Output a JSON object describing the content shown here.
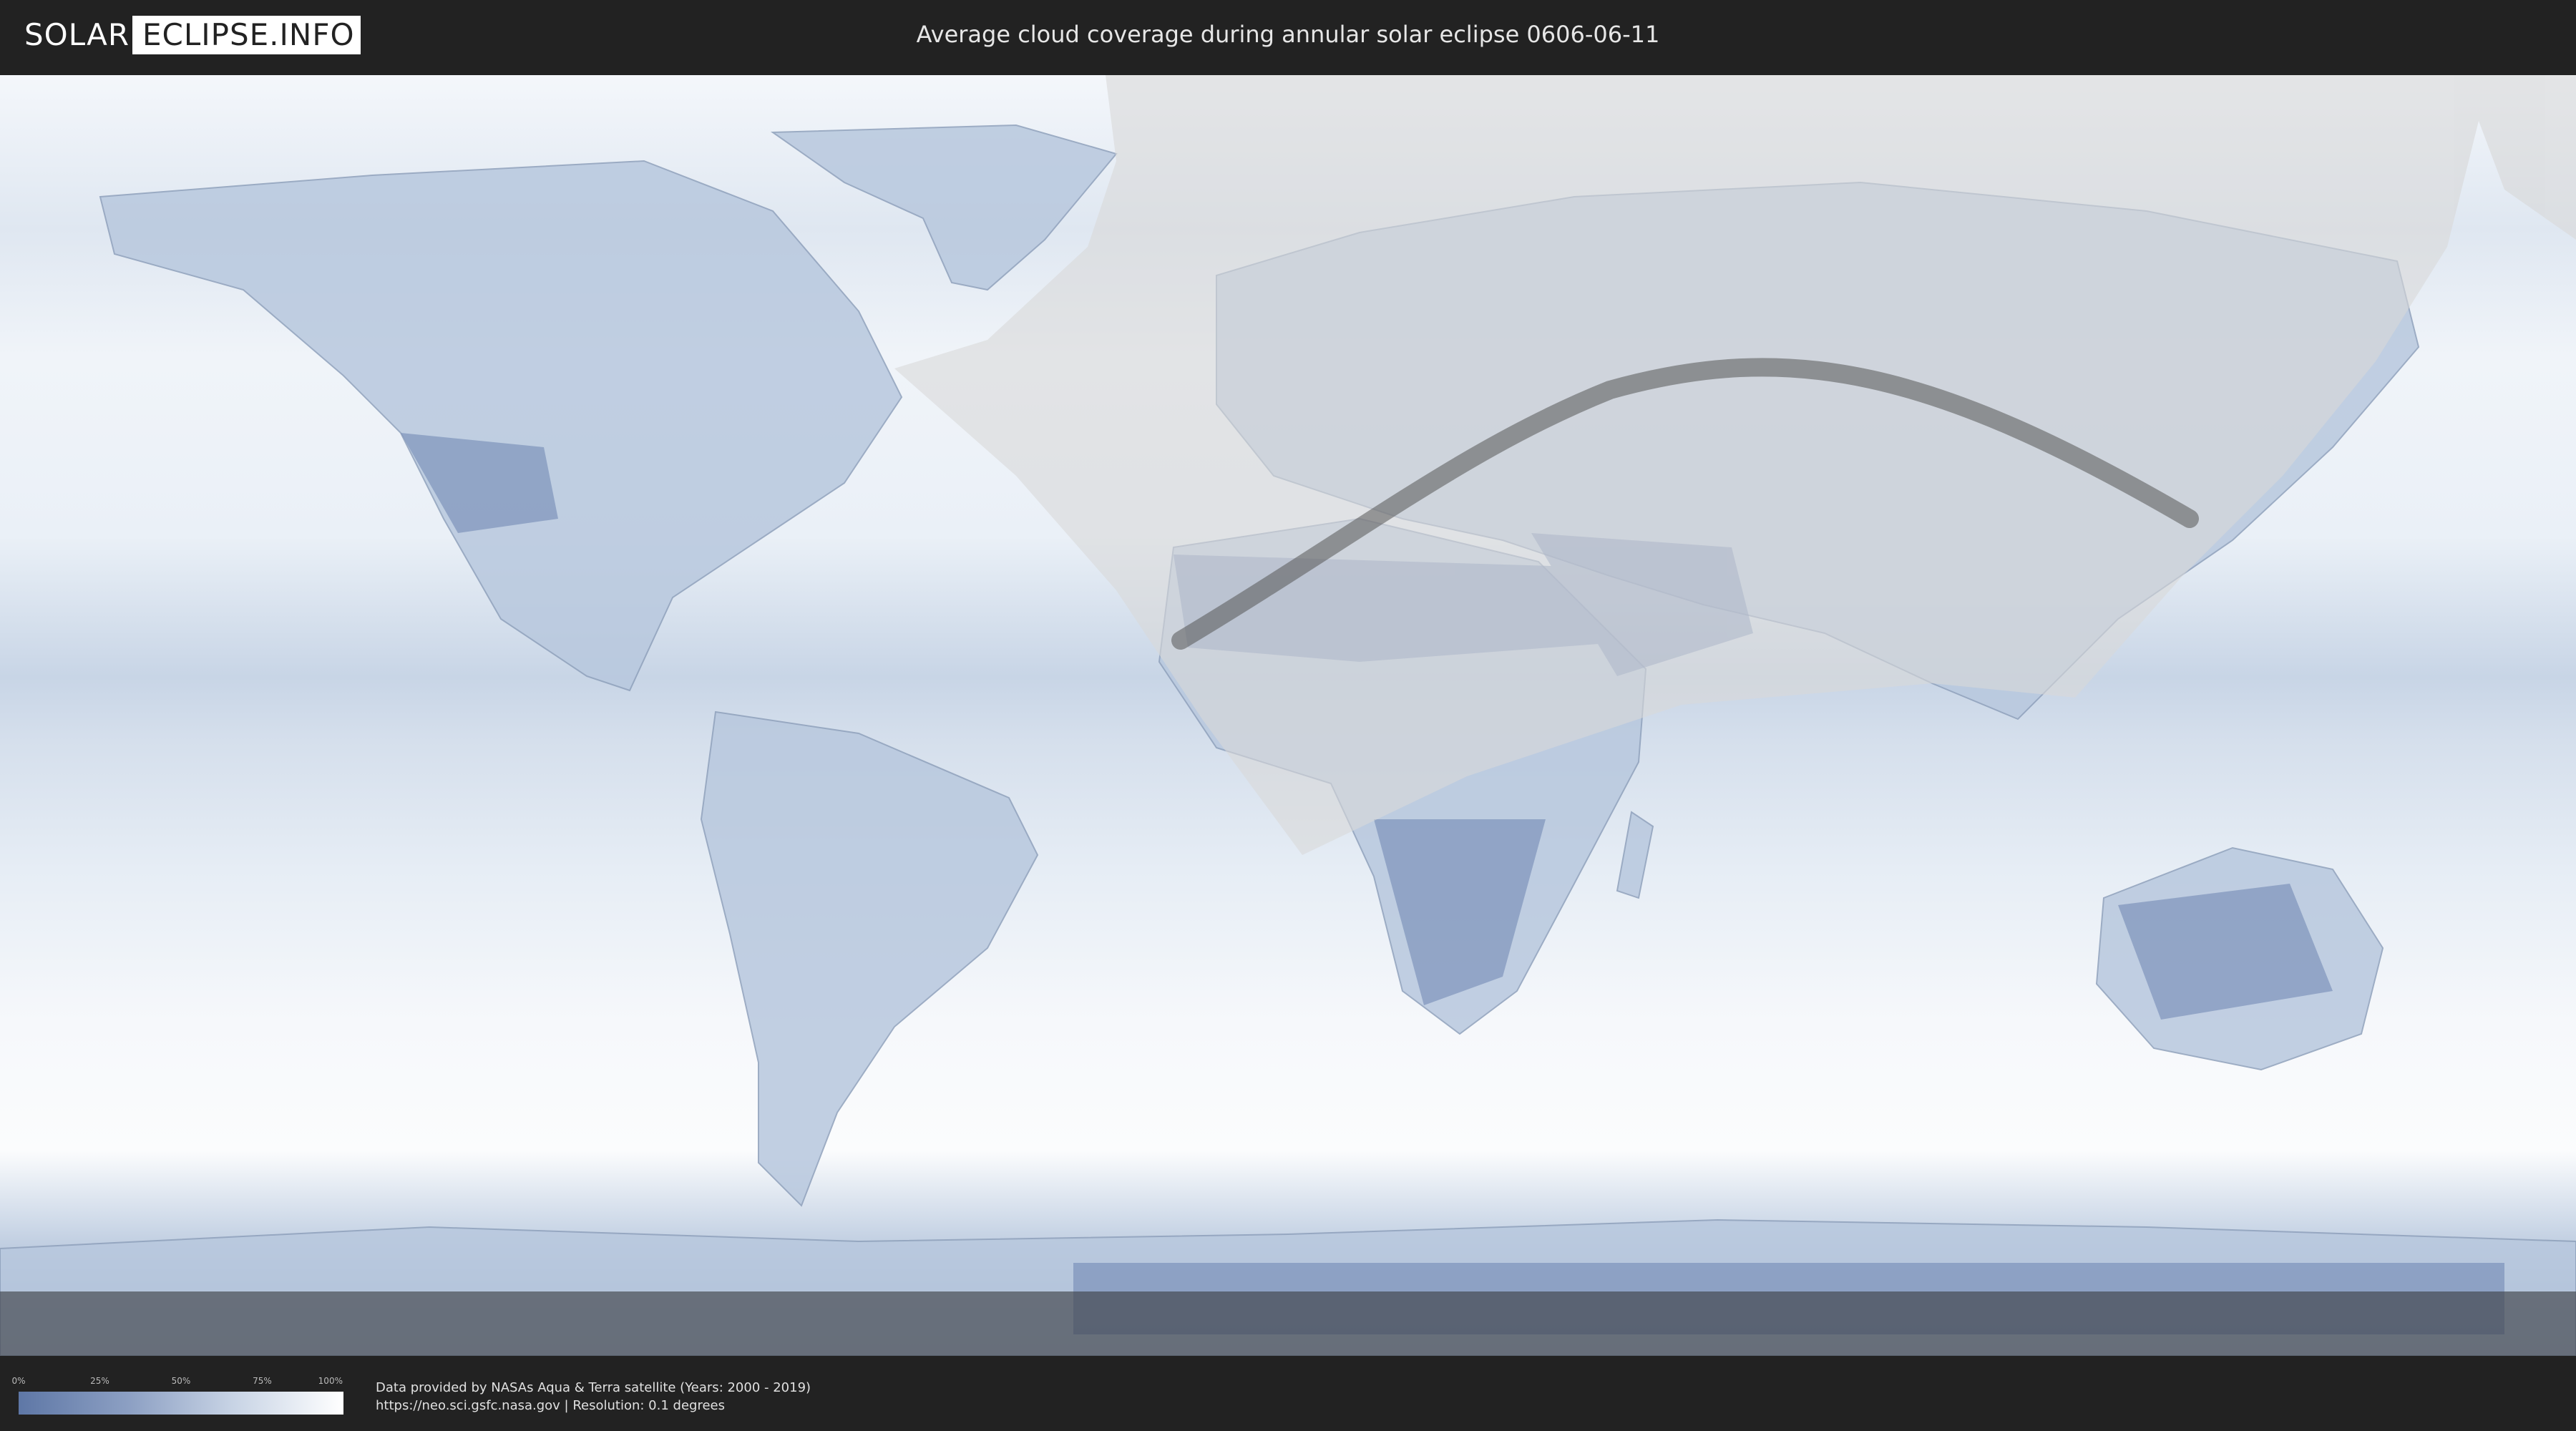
{
  "header": {
    "logo_left": "SOLAR",
    "logo_right": "ECLIPSE.INFO",
    "title": "Average cloud coverage during annular solar eclipse 0606-06-11"
  },
  "legend": {
    "ticks": [
      "0%",
      "25%",
      "50%",
      "75%",
      "100%"
    ],
    "color_low": "#5e77a6",
    "color_high": "#ffffff"
  },
  "footer": {
    "credit_line1": "Data provided by NASAs Aqua & Terra satellite (Years: 2000 - 2019)",
    "credit_line2": "https://neo.sci.gsfc.nasa.gov | Resolution: 0.1 degrees"
  },
  "colors": {
    "background": "#222222",
    "ocean_clouds": "#e8eef6",
    "clear_sky": "#5e77a6",
    "eclipse_shadow": "#d8d8d8",
    "central_path": "#555555"
  }
}
